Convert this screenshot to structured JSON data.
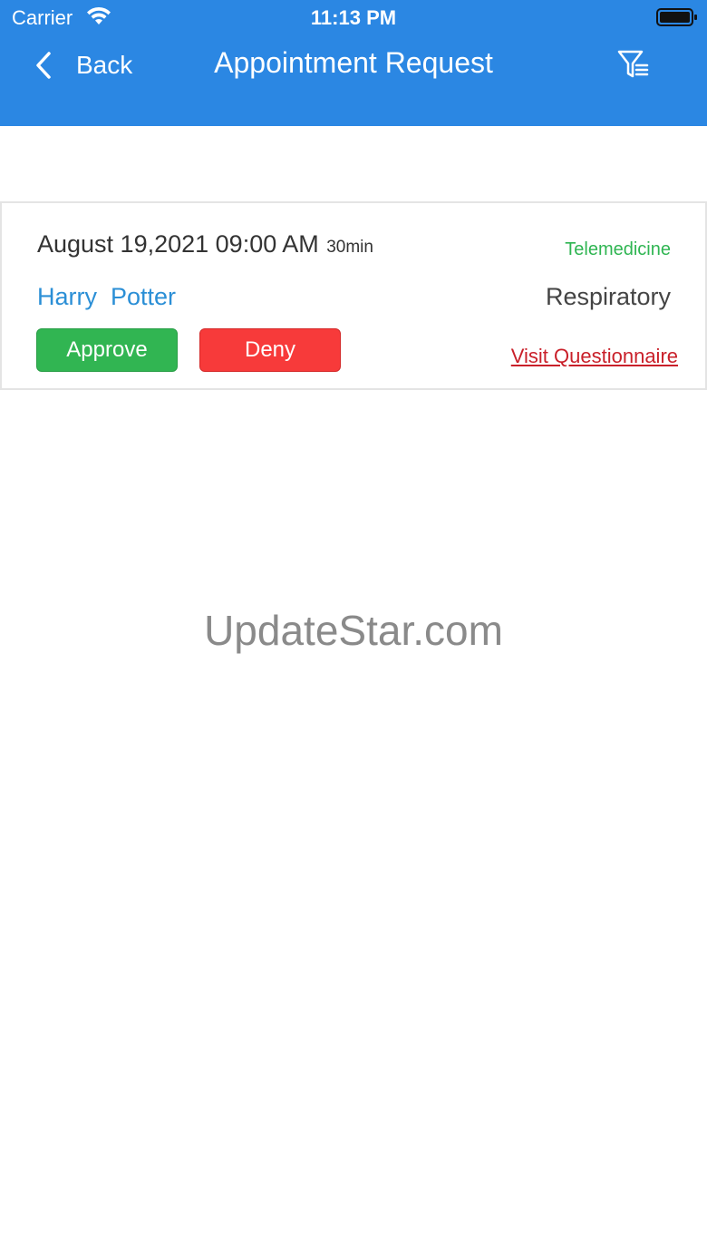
{
  "status_bar": {
    "carrier": "Carrier",
    "time": "11:13 PM",
    "icons": [
      "wifi-icon",
      "battery-icon"
    ]
  },
  "nav": {
    "back_label": "Back",
    "title": "Appointment Request",
    "filter_icon": "filter-icon"
  },
  "appointment": {
    "date": "August 19,2021 09:00 AM",
    "duration": "30min",
    "visit_type": "Telemedicine",
    "patient_name": "Harry  Potter",
    "specialty": "Respiratory",
    "approve_label": "Approve",
    "deny_label": "Deny",
    "questionnaire_label": "Visit Questionnaire"
  },
  "watermark": "UpdateStar.com",
  "colors": {
    "header": "#2b87e3",
    "approve": "#31b552",
    "deny": "#f73a3a",
    "link": "#c9202a",
    "name": "#2b8fd6",
    "visit_type": "#2fb552"
  }
}
